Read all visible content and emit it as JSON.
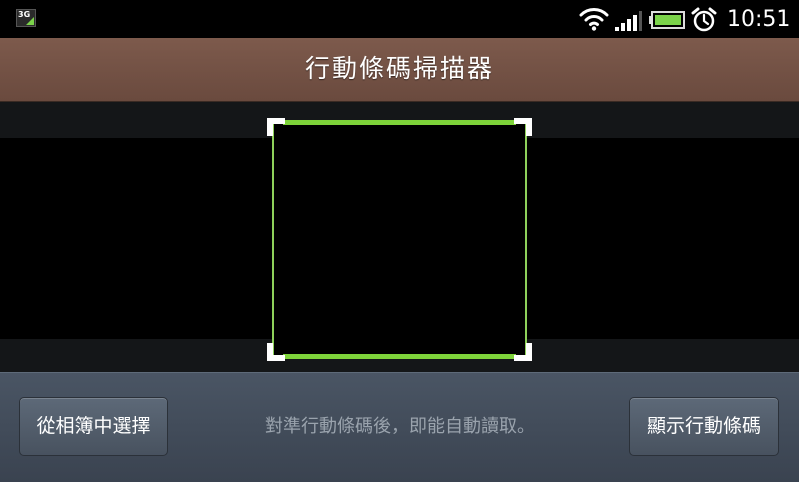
{
  "status_bar": {
    "network_badge": "3G",
    "time": "10:51",
    "icons": [
      "wifi-icon",
      "signal-icon",
      "battery-icon",
      "alarm-icon"
    ],
    "battery_color": "#7bd34a"
  },
  "title_bar": {
    "title": "行動條碼掃描器",
    "background": "#7d5a4c"
  },
  "viewfinder": {
    "frame_color": "#7ed33a"
  },
  "bottom_bar": {
    "left_button": "從相簿中選擇",
    "hint": "對準行動條碼後，即能自動讀取。",
    "right_button": "顯示行動條碼"
  }
}
